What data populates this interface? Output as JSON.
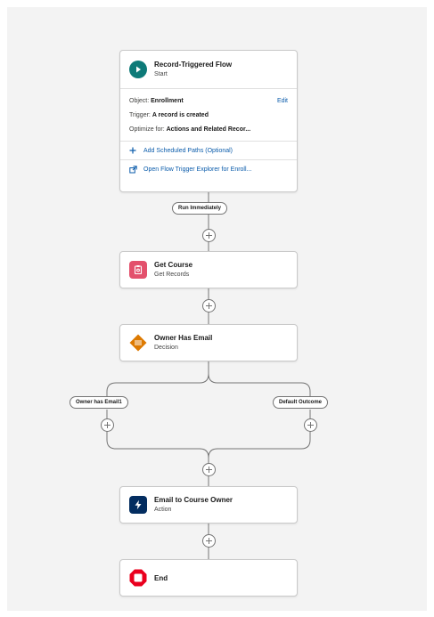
{
  "start": {
    "title": "Record-Triggered Flow",
    "subtitle": "Start",
    "object_label": "Object: ",
    "object_value": "Enrollment",
    "edit_label": "Edit",
    "trigger_label": "Trigger: ",
    "trigger_value": "A record is created",
    "optimize_label": "Optimize for: ",
    "optimize_value": "Actions and Related Recor...",
    "add_paths_label": "Add Scheduled Paths (Optional)",
    "open_explorer_label": "Open Flow Trigger Explorer for Enroll..."
  },
  "run_immediately_label": "Run Immediately",
  "nodes": {
    "get_course": {
      "title": "Get Course",
      "subtitle": "Get Records",
      "icon": "clipboard-icon",
      "color": "#e3506c"
    },
    "owner_has_email": {
      "title": "Owner Has Email",
      "subtitle": "Decision",
      "icon": "decision-icon",
      "color": "#dd7a01"
    },
    "email_owner": {
      "title": "Email to Course Owner",
      "subtitle": "Action",
      "icon": "lightning-icon",
      "color": "#032d60"
    },
    "end": {
      "title": "End",
      "icon": "stop-icon",
      "color": "#ea001e"
    }
  },
  "branches": {
    "left_label": "Owner has Email1",
    "right_label": "Default Outcome"
  },
  "colors": {
    "start_icon": "#0d7a78",
    "link": "#0b5cab",
    "connector": "#747474"
  }
}
